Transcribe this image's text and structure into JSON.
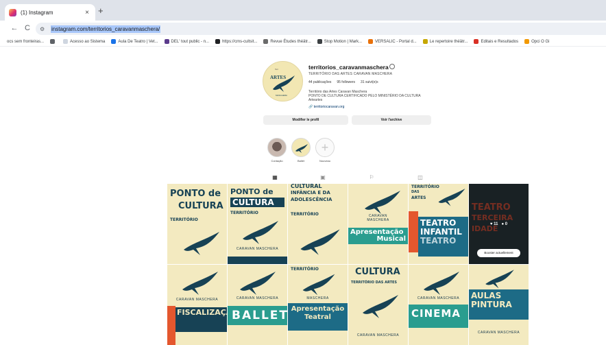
{
  "browser": {
    "tab_title": "(1) Instagram",
    "tab_close": "×",
    "new_tab": "+",
    "url": "instagram.com/territorios_caravanmaschera/",
    "back": "←",
    "reload": "C",
    "bookmarks": [
      {
        "label": "ocs sem fronteiras...",
        "color": "#ffffff"
      },
      {
        "label": "",
        "color": "#5f6368"
      },
      {
        "label": "Acesso ao Sistema",
        "color": "#cfd6e0"
      },
      {
        "label": "Aula De Teatro | Vet...",
        "color": "#1a73e8"
      },
      {
        "label": "DEL' tout public - n...",
        "color": "#5b3b8c"
      },
      {
        "label": "https://cms-cultsit...",
        "color": "#202124"
      },
      {
        "label": "Revue Études théâtr...",
        "color": "#6b6b6b"
      },
      {
        "label": "Stop Motion | Mark...",
        "color": "#3c4043"
      },
      {
        "label": "VERSALIC - Portal d...",
        "color": "#e8710a"
      },
      {
        "label": "Le repertoire théâtr...",
        "color": "#c6a700"
      },
      {
        "label": "Editais e Resultados",
        "color": "#d93025"
      },
      {
        "label": "Opci O Gi",
        "color": "#f29900"
      }
    ]
  },
  "profile": {
    "username": "territorios_caravanmaschera",
    "subtitle": "TERRITÓRIO DAS ARTES CARAVAN MASCHERA",
    "stats": [
      "44 publicações",
      "95 followers",
      "31 suivi(e)s"
    ],
    "bio": [
      "Território das Artes Caravan Maschera",
      "PONTO DE CULTURA CERTIFICADO PELO MINISTÉRIO DA CULTURA",
      "Arteartes"
    ],
    "link": "territoriocaravan.org",
    "edit_button": "Modifier le profil",
    "archive_button": "Voir l'archive"
  },
  "highlights": [
    {
      "label": "Contação"
    },
    {
      "label": "Ballet"
    },
    {
      "label": "Nouveau"
    }
  ],
  "highlight_plus": "+",
  "profile_tabs": {
    "posts_icon": "▦",
    "reels_icon": "▣",
    "saved_icon": "⚐",
    "tagged_icon": "◫"
  },
  "posts": [
    {
      "lines": [
        "PONTO de",
        "CULTURA"
      ]
    },
    {
      "lines": [
        "PONTO de",
        "CULTURA"
      ]
    },
    {
      "lines": [
        "CULTURAL",
        "INFÂNCIA E DA",
        "ADOLESCÊNCIA"
      ]
    },
    {
      "lines": [
        "TERRITÓRIO",
        "DAS",
        "ARTES"
      ]
    },
    {
      "lines": [
        "TERRITÓRIO",
        "DAS",
        "ARTES"
      ]
    },
    {
      "lines": [
        "TEATRO",
        "TERCEIRA",
        "IDADE"
      ],
      "overlay": {
        "likes": "♥ 11",
        "comments": "● 0",
        "button": "Booster actuellement"
      }
    },
    {
      "lines": [
        "TERRITÓRIO",
        "DAS",
        "ARTES"
      ],
      "caption": "CARAVAN MASCHERA"
    },
    {
      "lines": [
        "TERRITÓRIO",
        "DAS",
        "ARTES"
      ],
      "caption": "CARAVAN MASCHERA"
    },
    {
      "lines": [
        "CARAVAN",
        "MASCHERA"
      ],
      "bar": "Apresentação Musical"
    },
    {
      "lines": [
        "TEATRO",
        "INFANTIL"
      ]
    },
    {
      "lines": [
        "CULTURA",
        "TERRITÓRIO DAS ARTES"
      ],
      "caption": "CARAVAN MASCHERA"
    },
    {
      "lines": [
        "AULAS",
        "PINTURA"
      ],
      "caption": "CARAVAN MASCHERA"
    }
  ],
  "grid_texts": {
    "ballet": "BALLET",
    "teatral": "Apresentação Teatral",
    "cinema": "CINEMA",
    "mascara": "CARAVAN MASCHERA",
    "fiscalizacao": "FISCALIZAÇÃO",
    "apresentacao": "Apresentação",
    "musical": "Musical",
    "teatro": "TEATRO",
    "infantil": "INFANTIL",
    "cultura": "CULTURA"
  }
}
